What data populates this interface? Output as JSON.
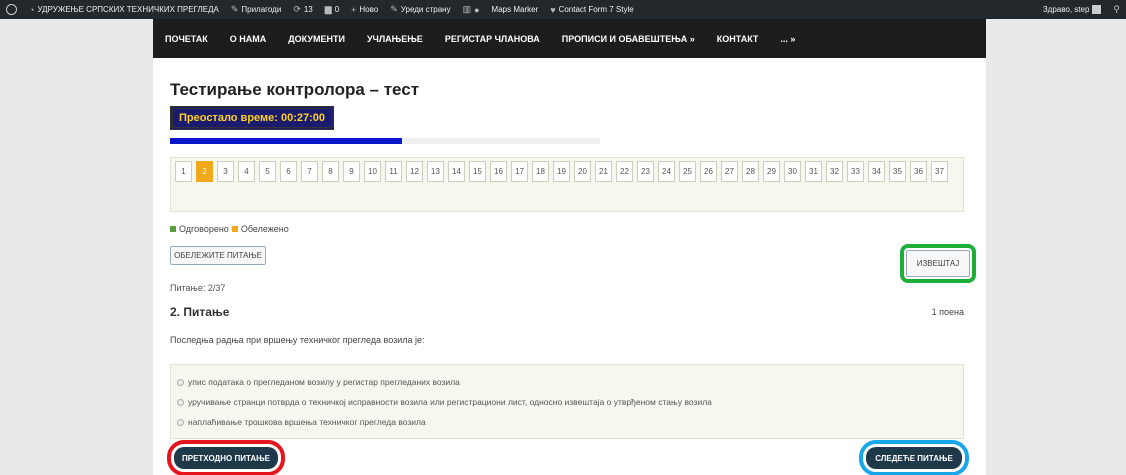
{
  "adminbar": {
    "site_name": "УДРУЖЕЊЕ СРПСКИХ ТЕХНИЧКИХ ПРЕГЛЕДА",
    "customize": "Прилагоди",
    "updates_count": "13",
    "comments_count": "0",
    "new_label": "Ново",
    "edit_page": "Уреди страну",
    "maps_marker": "Maps Marker",
    "contact_form": "Contact Form 7 Style",
    "greeting": "Здраво, step"
  },
  "nav": {
    "items": [
      "ПОЧЕТАК",
      "О НАМА",
      "ДОКУМЕНТИ",
      "УЧЛАЊЕЊЕ",
      "РЕГИСТАР ЧЛАНОВА",
      "ПРОПИСИ И ОБАВЕШТЕЊА »",
      "КОНТАКТ",
      "... »"
    ]
  },
  "quiz": {
    "title": "Тестирање контролора – тест",
    "timer_label": "Преостало време: 00:27:00",
    "time_progress": 0.54,
    "question_numbers": [
      "1",
      "2",
      "3",
      "4",
      "5",
      "6",
      "7",
      "8",
      "9",
      "10",
      "11",
      "12",
      "13",
      "14",
      "15",
      "16",
      "17",
      "18",
      "19",
      "20",
      "21",
      "22",
      "23",
      "24",
      "25",
      "26",
      "27",
      "28",
      "29",
      "30",
      "31",
      "32",
      "33",
      "34",
      "35",
      "36",
      "37"
    ],
    "active_question": "2",
    "legend_answered": "Одговорено",
    "legend_marked": "Обележено",
    "legend_answered_color": "#5a9e3c",
    "legend_marked_color": "#f1a91c",
    "mark_button": "ОБЕЛЕЖИТЕ ПИТАЊЕ",
    "report_button": "ИЗВЕШТАЈ",
    "counter": "Питање: 2/37",
    "heading": "2. Питање",
    "points": "1 поена",
    "question_text": "Последња радња при вршењу техничког прегледа возила је:",
    "answers": [
      "упис података о прегледаном возилу у регистар прегледаних возила",
      "уручивање странци потврда о техничкој исправности возила или регистрациони лист, односно извештаја о утврђеном стању возила",
      "наплаћивање трошкова вршења техничког прегледа возила"
    ],
    "prev_button": "ПРЕТХОДНО ПИТАЊЕ",
    "next_button": "СЛЕДЕЋЕ ПИТАЊЕ"
  }
}
